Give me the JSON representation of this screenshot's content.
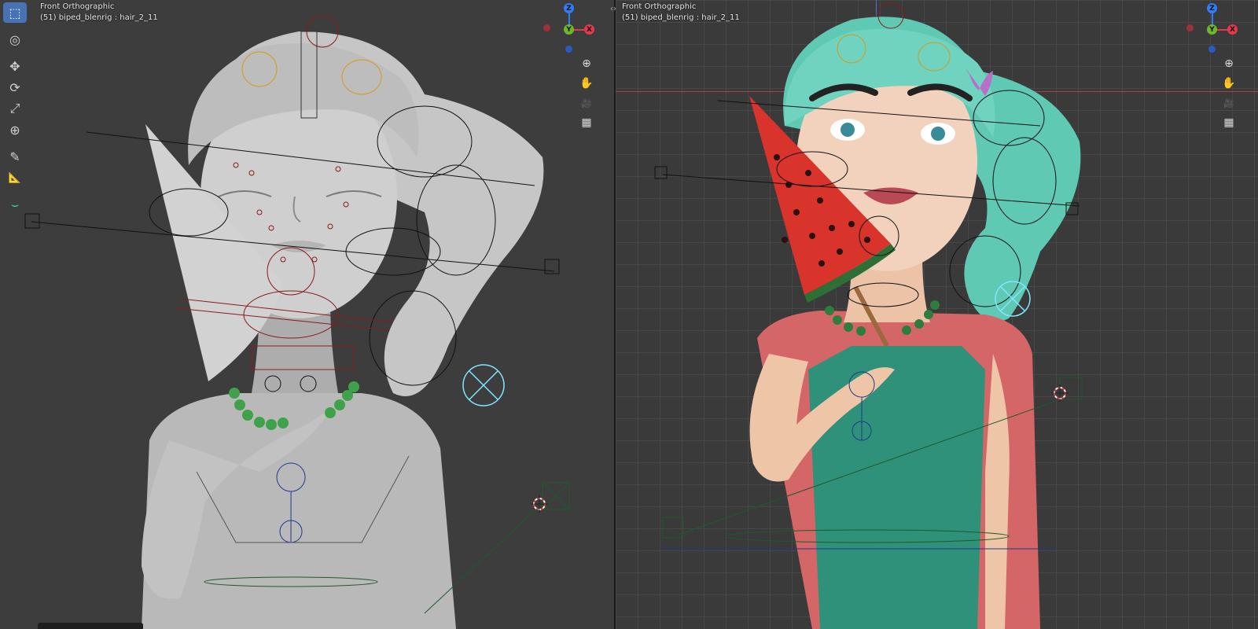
{
  "viewports": {
    "left": {
      "view_name": "Front Orthographic",
      "object_info": "(51) biped_blenrig : hair_2_11",
      "shading": "solid"
    },
    "right": {
      "view_name": "Front Orthographic",
      "object_info": "(51) biped_blenrig : hair_2_11",
      "shading": "rendered"
    }
  },
  "toolbar": {
    "tools": [
      {
        "name": "select-box",
        "icon": "cursor-box-icon",
        "glyph": "⬚",
        "active": true
      },
      {
        "name": "cursor",
        "icon": "cursor-icon",
        "glyph": "◎",
        "active": false
      },
      {
        "name": "move",
        "icon": "move-icon",
        "glyph": "✥",
        "active": false
      },
      {
        "name": "rotate",
        "icon": "rotate-icon",
        "glyph": "⟳",
        "active": false
      },
      {
        "name": "scale",
        "icon": "scale-icon",
        "glyph": "⤢",
        "active": false
      },
      {
        "name": "transform",
        "icon": "transform-icon",
        "glyph": "⊕",
        "active": false
      },
      {
        "name": "annotate",
        "icon": "annotate-icon",
        "glyph": "✎",
        "active": false
      },
      {
        "name": "measure",
        "icon": "measure-icon",
        "glyph": "📐",
        "active": false
      },
      {
        "name": "bone-curve",
        "icon": "curve-icon",
        "glyph": "⌣",
        "active": false
      }
    ]
  },
  "gizmo": {
    "axes": [
      {
        "label": "Z",
        "color": "#2f7df6"
      },
      {
        "label": "Y",
        "color": "#70b62c"
      },
      {
        "label": "X",
        "color": "#e3394d"
      }
    ]
  },
  "nav_buttons": [
    {
      "name": "zoom",
      "icon": "zoom-icon",
      "glyph": "⊕"
    },
    {
      "name": "pan",
      "icon": "hand-icon",
      "glyph": "✋"
    },
    {
      "name": "camera",
      "icon": "camera-icon",
      "glyph": "🎥"
    },
    {
      "name": "ortho-toggle",
      "icon": "grid-icon",
      "glyph": "▦"
    }
  ],
  "colors": {
    "accent": "#4772b3",
    "hair": "#6fd3bf",
    "watermelon": "#d9342b",
    "shirt": "#d76b6e",
    "overalls": "#2e8f76",
    "skin": "#f0cdb4",
    "bone_wire": "#111111",
    "bone_red": "#8a1a1a",
    "bone_green": "#1e5a2b",
    "bone_cyan": "#7fe6ff",
    "clay": "#c8c8c8"
  }
}
